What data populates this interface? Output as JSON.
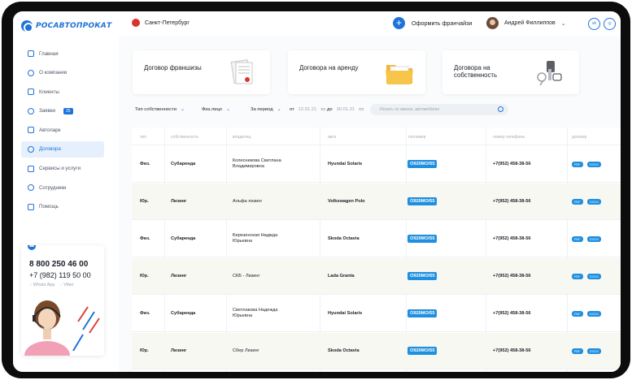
{
  "app": {
    "logo_text": "РОСАВТОПРОКАТ",
    "accent": "#1f73d8"
  },
  "sidebar": {
    "items": [
      {
        "label": "Главная",
        "icon": "home-icon"
      },
      {
        "label": "О компании",
        "icon": "info-icon"
      },
      {
        "label": "Клиенты",
        "icon": "clients-icon"
      },
      {
        "label": "Заявки",
        "icon": "requests-icon",
        "badge": "25"
      },
      {
        "label": "Автопарк",
        "icon": "car-icon"
      },
      {
        "label": "Договора",
        "icon": "contracts-icon",
        "active": true
      },
      {
        "label": "Сервисы и услуги",
        "icon": "services-icon"
      },
      {
        "label": "Сотрудники",
        "icon": "employees-icon"
      },
      {
        "label": "Помощь",
        "icon": "help-icon"
      }
    ],
    "contact": {
      "phone1": "8 800 250 46 00",
      "phone2": "+7 (982) 119 50 00",
      "whatsapp": "Whats App",
      "viber": "Viber"
    }
  },
  "header": {
    "city": "Санкт-Петербург",
    "franchise_label": "Оформить франчайзи",
    "user_name": "Андрей Филлиппов"
  },
  "cards": [
    {
      "label": "Договор франшизы",
      "icon": "documents-icon"
    },
    {
      "label": "Договора на аренду",
      "icon": "folder-icon"
    },
    {
      "label": "Договора на собственность",
      "icon": "keys-icon"
    }
  ],
  "filters": {
    "ownership": "Тип собственности",
    "person": "Физ.лицо",
    "period": "За период",
    "from_label": "от",
    "from_date": "12.01.21",
    "to_label": "до",
    "to_date": "30.01.21",
    "search_placeholder": "Искать по имени, автомобилю"
  },
  "table": {
    "headers": [
      "тип",
      "собственность",
      "владелец",
      "авто",
      "госномер",
      "номер телефона",
      "договор"
    ],
    "rows": [
      {
        "type": "Физ.",
        "ownership": "Субаренда",
        "owner": "Колесникова Светлана Владимировна",
        "car": "Hyundai Solaris",
        "plate": "О920МО/55",
        "phone": "+7(952) 458-38-56"
      },
      {
        "type": "Юр.",
        "ownership": "Лизинг",
        "owner": "Альфа лизинг",
        "car": "Volkswagen Polo",
        "plate": "О920МО/55",
        "phone": "+7(952) 458-38-56"
      },
      {
        "type": "Физ.",
        "ownership": "Субаренда",
        "owner": "Березенская Наджда Юрьевна",
        "car": "Skoda Octavia",
        "plate": "О920МО/55",
        "phone": "+7(952) 458-38-56"
      },
      {
        "type": "Юр.",
        "ownership": "Лизинг",
        "owner": "СКБ - Лизинг",
        "car": "Lada Granta",
        "plate": "О920МО/55",
        "phone": "+7(952) 458-38-56"
      },
      {
        "type": "Физ.",
        "ownership": "Субаренда",
        "owner": "Светлакова Надежда Юрьевна",
        "car": "Hyundai Solaris",
        "plate": "О920МО/55",
        "phone": "+7(952) 458-38-56"
      },
      {
        "type": "Юр.",
        "ownership": "Лизинг",
        "owner": "Сбер Лизинг",
        "car": "Skoda Octavia",
        "plate": "О920МО/55",
        "phone": "+7(952) 458-38-56"
      }
    ],
    "doc_pdf": "PDF",
    "doc_docx": "DOCX"
  }
}
